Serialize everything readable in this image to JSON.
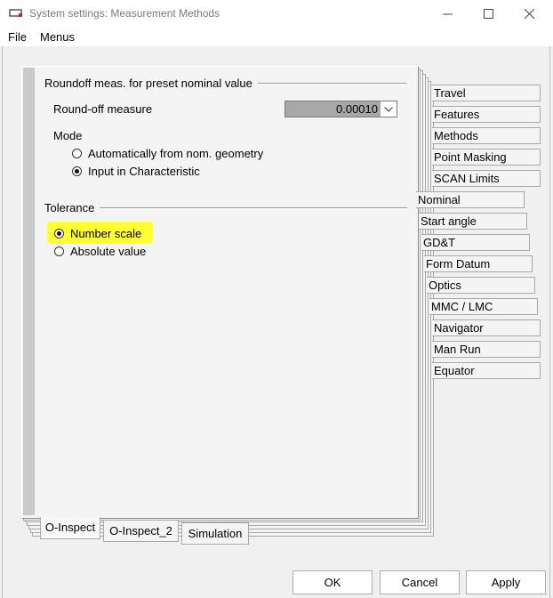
{
  "window": {
    "title": "System settings: Measurement Methods",
    "minimize_icon": "minimize-icon",
    "maximize_icon": "maximize-icon",
    "close_icon": "close-icon"
  },
  "menubar": {
    "items": [
      "File",
      "Menus"
    ]
  },
  "roundoff": {
    "group_title": "Roundoff  meas. for preset nominal value",
    "measure_label": "Round-off measure",
    "measure_value": "0.00010",
    "mode_label": "Mode",
    "mode_options": [
      "Automatically from nom. geometry",
      "Input in Characteristic"
    ],
    "mode_selected": 1
  },
  "tolerance": {
    "group_title": "Tolerance",
    "options": [
      "Number scale",
      "Absolute value"
    ],
    "selected": 0,
    "highlight_color": "#ffff33"
  },
  "side_tabs": [
    "Travel",
    "Features",
    "Methods",
    "Point Masking",
    "SCAN Limits",
    "Nominal",
    "Start angle",
    "GD&T",
    "Form Datum",
    "Optics",
    "MMC / LMC",
    "Navigator",
    "Man Run",
    "Equator"
  ],
  "bottom_tabs": [
    "O-Inspect",
    "O-Inspect_2",
    "Simulation"
  ],
  "active_bottom_tab": 0,
  "buttons": {
    "ok": "OK",
    "cancel": "Cancel",
    "apply": "Apply"
  }
}
